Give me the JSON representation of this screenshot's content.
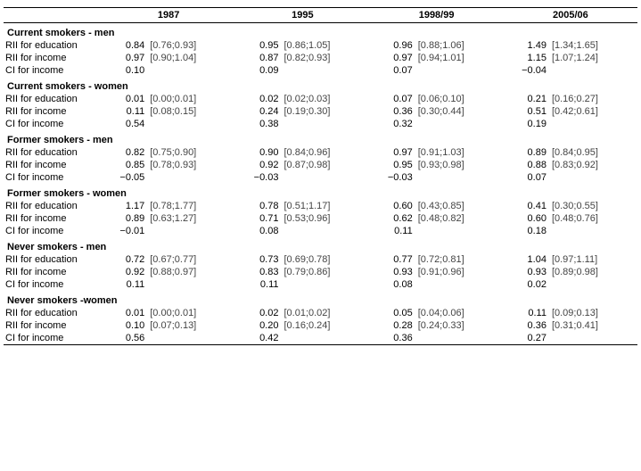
{
  "columns": {
    "years": [
      "1987",
      "1995",
      "1998/99",
      "2005/06"
    ]
  },
  "sections": [
    {
      "title": "Current smokers - men",
      "rows": [
        {
          "label": "RII for education",
          "values": [
            "0.84",
            "0.95",
            "0.96",
            "1.49"
          ],
          "cis": [
            "[0.76;0.93]",
            "[0.86;1.05]",
            "[0.88;1.06]",
            "[1.34;1.65]"
          ]
        },
        {
          "label": "RII for income",
          "values": [
            "0.97",
            "0.87",
            "0.97",
            "1.15"
          ],
          "cis": [
            "[0.90;1.04]",
            "[0.82;0.93]",
            "[0.94;1.01]",
            "[1.07;1.24]"
          ]
        },
        {
          "label": "CI for income",
          "values": [
            "0.10",
            "0.09",
            "0.07",
            "−0.04"
          ],
          "cis": [
            "",
            "",
            "",
            ""
          ]
        }
      ]
    },
    {
      "title": "Current smokers - women",
      "rows": [
        {
          "label": "RII for education",
          "values": [
            "0.01",
            "0.02",
            "0.07",
            "0.21"
          ],
          "cis": [
            "[0.00;0.01]",
            "[0.02;0.03]",
            "[0.06;0.10]",
            "[0.16;0.27]"
          ]
        },
        {
          "label": "RII for income",
          "values": [
            "0.11",
            "0.24",
            "0.36",
            "0.51"
          ],
          "cis": [
            "[0.08;0.15]",
            "[0.19;0.30]",
            "[0.30;0.44]",
            "[0.42;0.61]"
          ]
        },
        {
          "label": "CI for income",
          "values": [
            "0.54",
            "0.38",
            "0.32",
            "0.19"
          ],
          "cis": [
            "",
            "",
            "",
            ""
          ]
        }
      ]
    },
    {
      "title": "Former smokers - men",
      "rows": [
        {
          "label": "RII for education",
          "values": [
            "0.82",
            "0.90",
            "0.97",
            "0.89"
          ],
          "cis": [
            "[0.75;0.90]",
            "[0.84;0.96]",
            "[0.91;1.03]",
            "[0.84;0.95]"
          ]
        },
        {
          "label": "RII for income",
          "values": [
            "0.85",
            "0.92",
            "0.95",
            "0.88"
          ],
          "cis": [
            "[0.78;0.93]",
            "[0.87;0.98]",
            "[0.93;0.98]",
            "[0.83;0.92]"
          ]
        },
        {
          "label": "CI for income",
          "values": [
            "−0.05",
            "−0.03",
            "−0.03",
            "0.07"
          ],
          "cis": [
            "",
            "",
            "",
            ""
          ]
        }
      ]
    },
    {
      "title": "Former smokers - women",
      "rows": [
        {
          "label": "RII for education",
          "values": [
            "1.17",
            "0.78",
            "0.60",
            "0.41"
          ],
          "cis": [
            "[0.78;1.77]",
            "[0.51;1.17]",
            "[0.43;0.85]",
            "[0.30;0.55]"
          ]
        },
        {
          "label": "RII for income",
          "values": [
            "0.89",
            "0.71",
            "0.62",
            "0.60"
          ],
          "cis": [
            "[0.63;1.27]",
            "[0.53;0.96]",
            "[0.48;0.82]",
            "[0.48;0.76]"
          ]
        },
        {
          "label": "CI for income",
          "values": [
            "−0.01",
            "0.08",
            "0.11",
            "0.18"
          ],
          "cis": [
            "",
            "",
            "",
            ""
          ]
        }
      ]
    },
    {
      "title": "Never smokers - men",
      "rows": [
        {
          "label": "RII for education",
          "values": [
            "0.72",
            "0.73",
            "0.77",
            "1.04"
          ],
          "cis": [
            "[0.67;0.77]",
            "[0.69;0.78]",
            "[0.72;0.81]",
            "[0.97;1.11]"
          ]
        },
        {
          "label": "RII for income",
          "values": [
            "0.92",
            "0.83",
            "0.93",
            "0.93"
          ],
          "cis": [
            "[0.88;0.97]",
            "[0.79;0.86]",
            "[0.91;0.96]",
            "[0.89;0.98]"
          ]
        },
        {
          "label": "CI for income",
          "values": [
            "0.11",
            "0.11",
            "0.08",
            "0.02"
          ],
          "cis": [
            "",
            "",
            "",
            ""
          ]
        }
      ]
    },
    {
      "title": "Never smokers -women",
      "rows": [
        {
          "label": "RII for education",
          "values": [
            "0.01",
            "0.02",
            "0.05",
            "0.11"
          ],
          "cis": [
            "[0.00;0.01]",
            "[0.01;0.02]",
            "[0.04;0.06]",
            "[0.09;0.13]"
          ]
        },
        {
          "label": "RII for income",
          "values": [
            "0.10",
            "0.20",
            "0.28",
            "0.36"
          ],
          "cis": [
            "[0.07;0.13]",
            "[0.16;0.24]",
            "[0.24;0.33]",
            "[0.31;0.41]"
          ]
        },
        {
          "label": "CI for income",
          "values": [
            "0.56",
            "0.42",
            "0.36",
            "0.27"
          ],
          "cis": [
            "",
            "",
            "",
            ""
          ],
          "last": true
        }
      ]
    }
  ]
}
